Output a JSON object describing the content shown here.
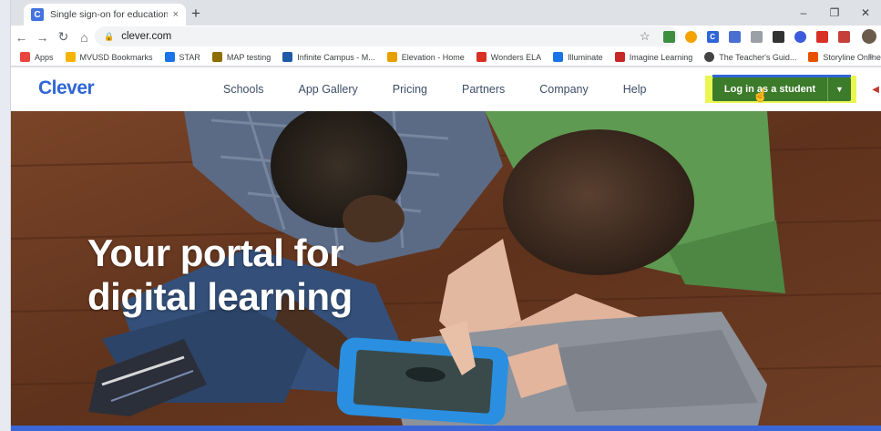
{
  "browser": {
    "tab_title": "Single sign-on for education | Cl",
    "tab_favicon_letter": "C",
    "tab_close": "×",
    "new_tab": "+",
    "window_controls": {
      "minimize": "–",
      "restore": "❐",
      "close": "✕"
    },
    "url": "clever.com",
    "bookmarks": [
      {
        "label": "Apps",
        "icon": "apps-grid-icon",
        "color": "#e8453c"
      },
      {
        "label": "MVUSD Bookmarks",
        "icon": "folder-icon",
        "color": "#f4b400"
      },
      {
        "label": "STAR",
        "icon": "star-r-icon",
        "color": "#1a73e8"
      },
      {
        "label": "MAP testing",
        "icon": "map-icon",
        "color": "#8d6e00"
      },
      {
        "label": "Infinite Campus - M...",
        "icon": "campus-icon",
        "color": "#1e5aa8"
      },
      {
        "label": "Elevation - Home",
        "icon": "bars-icon",
        "color": "#e8a000"
      },
      {
        "label": "Wonders ELA",
        "icon": "wonders-icon",
        "color": "#d93025"
      },
      {
        "label": "Illuminate",
        "icon": "illuminate-icon",
        "color": "#1a73e8"
      },
      {
        "label": "Imagine Learning",
        "icon": "imagine-icon",
        "color": "#c62828"
      },
      {
        "label": "The Teacher's Guid...",
        "icon": "globe-icon",
        "color": "#444444"
      },
      {
        "label": "Storyline Online -...",
        "icon": "storyline-icon",
        "color": "#e65100"
      }
    ],
    "bookmarks_more": "»"
  },
  "site": {
    "logo": "Clever",
    "nav": [
      "Schools",
      "App Gallery",
      "Pricing",
      "Partners",
      "Company",
      "Help"
    ],
    "login_label": "Log in as a student",
    "login_caret": "▼"
  },
  "hero": {
    "title_line1": "Your portal for",
    "title_line2": "digital learning"
  },
  "colors": {
    "brand_blue": "#2f66d6",
    "login_green": "#3b7b2a",
    "highlight_yellow": "#e6f534"
  }
}
